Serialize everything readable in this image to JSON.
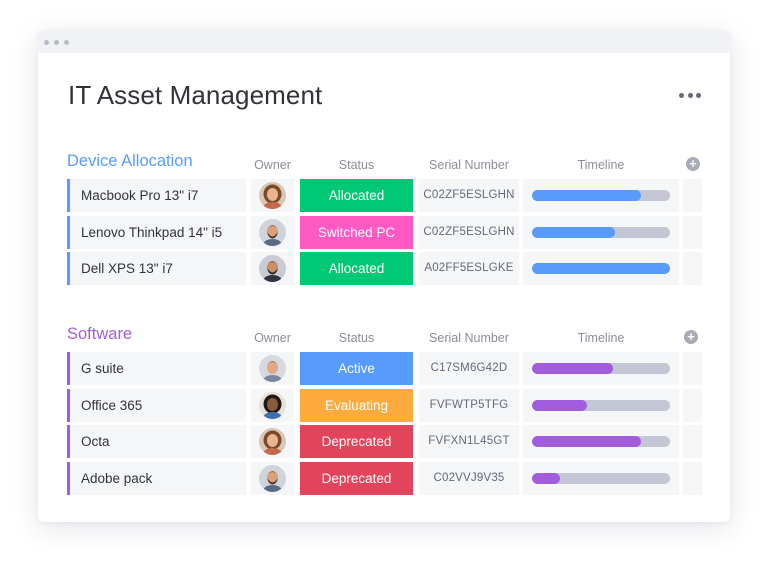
{
  "board": {
    "title": "IT Asset Management"
  },
  "columns": {
    "owner": "Owner",
    "status": "Status",
    "serial": "Serial Number",
    "timeline": "Timeline"
  },
  "colors": {
    "allocated": "#00c875",
    "switched_pc": "#ff5ac4",
    "active": "#579bfc",
    "evaluating": "#fdab3d",
    "deprecated": "#e2445c",
    "device_group": "#579bfc",
    "software_group": "#a25ddc"
  },
  "groups": [
    {
      "title": "Device Allocation",
      "color": "#579bfc",
      "rows": [
        {
          "name": "Macbook Pro 13\" i7",
          "owner_icon": "woman-curly-hair-avatar",
          "status": "Allocated",
          "status_color": "#00c875",
          "serial": "C02ZF5ESLGHN",
          "timeline_progress": 0.79
        },
        {
          "name": "Lenovo Thinkpad 14\" i5",
          "owner_icon": "man-beard-avatar",
          "status": "Switched PC",
          "status_color": "#ff5ac4",
          "serial": "C02ZF5ESLGHN",
          "timeline_progress": 0.6
        },
        {
          "name": "Dell XPS 13\" i7",
          "owner_icon": "man-bald-beard-avatar",
          "status": "Allocated",
          "status_color": "#00c875",
          "serial": "A02FF5ESLGKE",
          "timeline_progress": 1.0
        }
      ]
    },
    {
      "title": "Software",
      "color": "#a25ddc",
      "rows": [
        {
          "name": "G suite",
          "owner_icon": "man-short-hair-avatar",
          "status": "Active",
          "status_color": "#579bfc",
          "serial": "C17SM6G42D",
          "timeline_progress": 0.59
        },
        {
          "name": "Office 365",
          "owner_icon": "woman-dark-hair-avatar",
          "status": "Evaluating",
          "status_color": "#fdab3d",
          "serial": "FVFWTP5TFG",
          "timeline_progress": 0.4
        },
        {
          "name": "Octa",
          "owner_icon": "woman-curly-hair-avatar",
          "status": "Deprecated",
          "status_color": "#e2445c",
          "serial": "FVFXN1L45GT",
          "timeline_progress": 0.79
        },
        {
          "name": "Adobe pack",
          "owner_icon": "man-beard-avatar",
          "status": "Deprecated",
          "status_color": "#e2445c",
          "serial": "C02VVJ9V35",
          "timeline_progress": 0.2
        }
      ]
    }
  ]
}
